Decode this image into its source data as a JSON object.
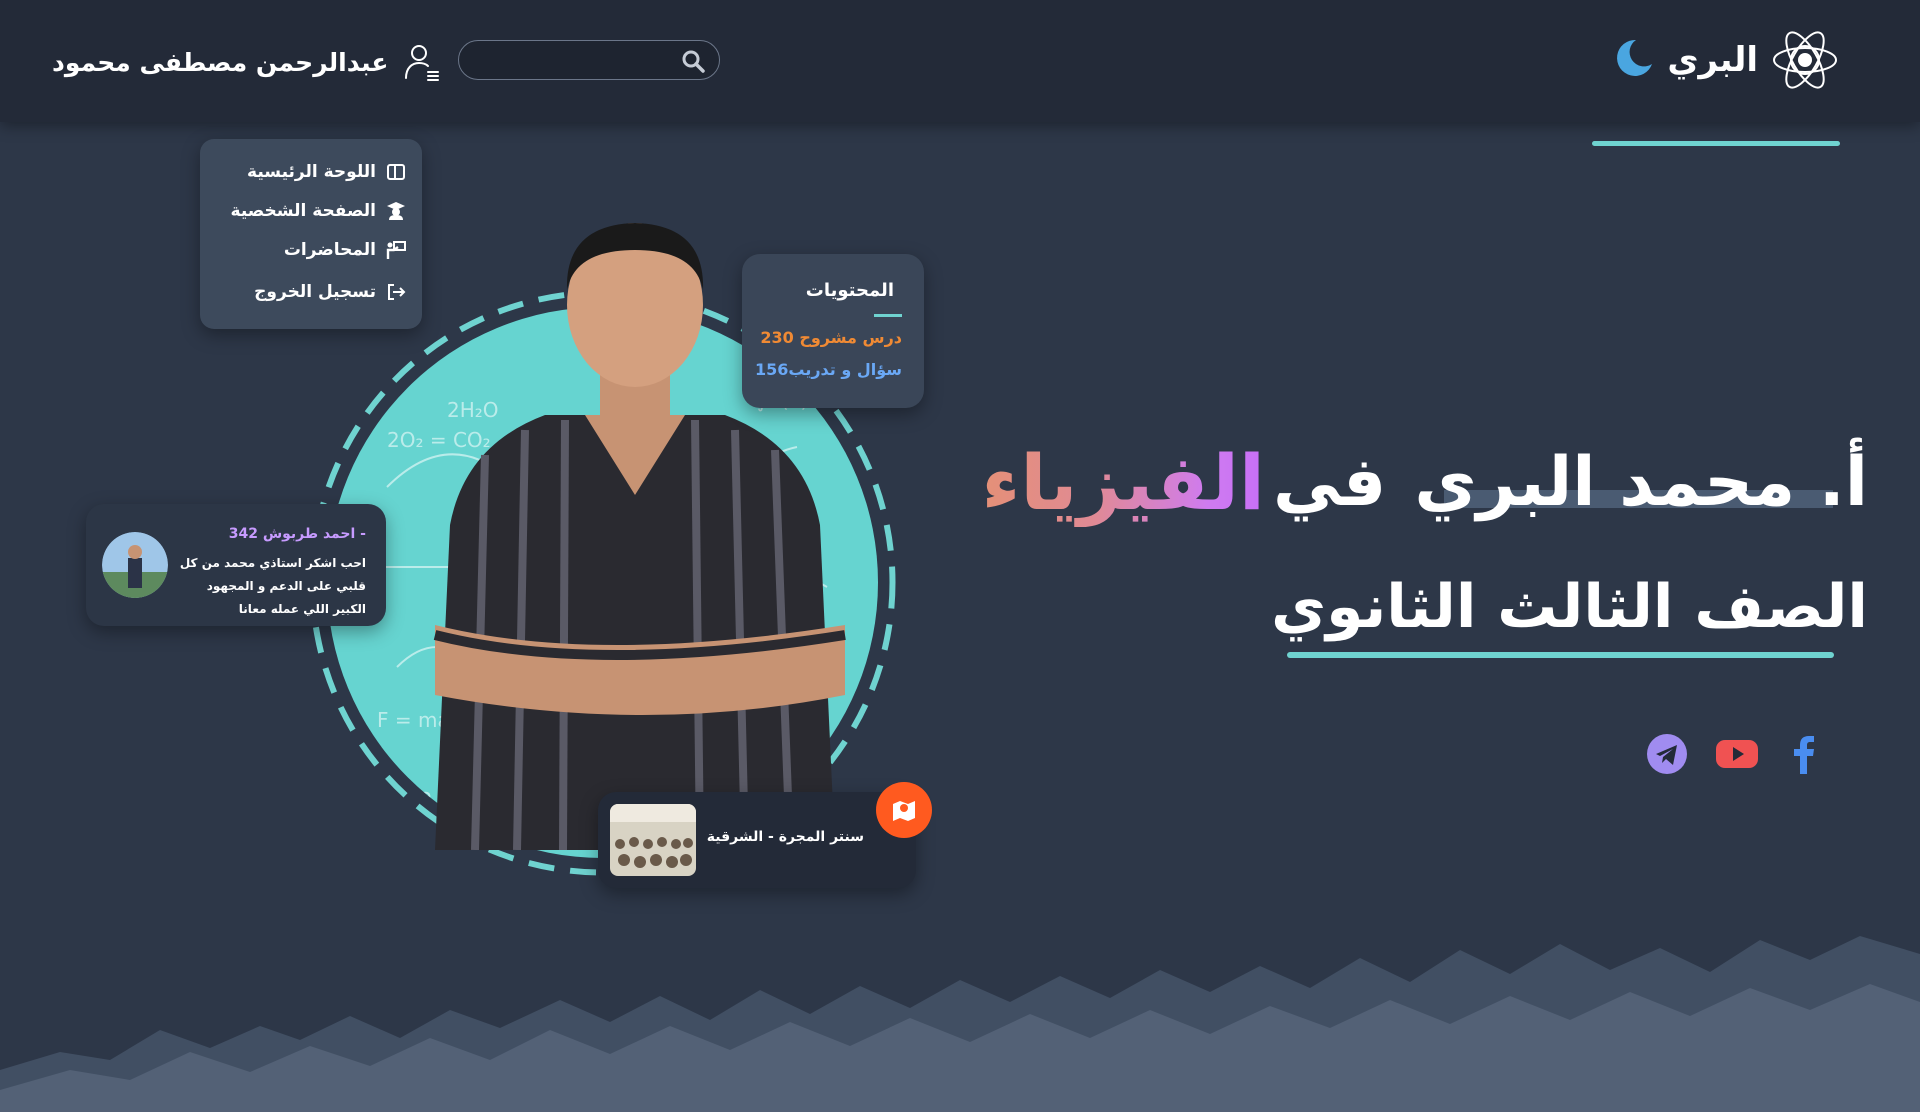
{
  "header": {
    "brand_name": "البري",
    "search": {
      "placeholder": "",
      "value": ""
    },
    "user_name": "عبدالرحمن مصطفى محمود",
    "icons": {
      "logo": "atom-icon",
      "theme": "moon-icon",
      "search": "search-icon",
      "user": "user-list-icon"
    },
    "colors": {
      "accent": "#6fd3d0",
      "moon": "#4aa6e0"
    }
  },
  "menu": {
    "items": [
      {
        "label": "اللوحة الرئيسية",
        "icon": "dashboard-icon"
      },
      {
        "label": "الصفحة الشخصية",
        "icon": "graduate-icon"
      },
      {
        "label": "المحاضرات",
        "icon": "lecture-icon"
      },
      {
        "label": "تسجيل الخروج",
        "icon": "logout-icon"
      }
    ]
  },
  "stats": {
    "title": "المحتويات",
    "lessons": "230 درس مشروح",
    "questions": "156سؤال و تدريب",
    "colors": {
      "lessons": "#f08a34",
      "questions": "#6aa8f5"
    }
  },
  "review": {
    "name": "احمد طربوش 342 -",
    "text": "احب اشكر استاذي محمد من كل قلبي على الدعم و المجهود الكبير اللي عمله معانا"
  },
  "center": {
    "label": "سنتر المجرة - الشرقية",
    "icon": "map-pin-icon",
    "color": "#ff5a1f"
  },
  "hero": {
    "prefix": "أ. محمد البري",
    "in": "في",
    "subject": "الفيزياء",
    "grade": "الصف الثالث الثانوي"
  },
  "social": [
    {
      "name": "facebook",
      "icon": "facebook-icon",
      "color": "#4a8df0"
    },
    {
      "name": "youtube",
      "icon": "youtube-icon",
      "color": "#f05252"
    },
    {
      "name": "telegram",
      "icon": "telegram-icon",
      "color": "#a08cf0"
    }
  ]
}
